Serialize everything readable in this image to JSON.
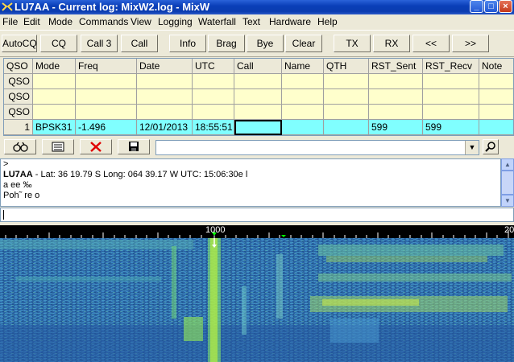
{
  "titlebar": {
    "title": "LU7AA - Current log: MixW2.log - MixW",
    "minimize": "_",
    "maximize": "□",
    "close": "×"
  },
  "menu": [
    "File",
    "Edit",
    "Mode",
    "Commands",
    "View",
    "Logging",
    "Waterfall",
    "Text",
    "Hardware",
    "Help"
  ],
  "toolbar": [
    "AutoCQ",
    "CQ",
    "Call 3",
    "Call",
    "Info",
    "Brag",
    "Bye",
    "Clear",
    "TX",
    "RX",
    "<<",
    ">>"
  ],
  "log": {
    "headers": [
      "QSO",
      "Mode",
      "Freq",
      "Date",
      "UTC",
      "Call",
      "Name",
      "QTH",
      "RST_Sent",
      "RST_Recv",
      "Note"
    ],
    "empty_rows": [
      "QSO",
      "QSO",
      "QSO"
    ],
    "current": {
      "num": "1",
      "mode": "BPSK31",
      "freq": "-1.496",
      "date": "12/01/2013",
      "utc": "18:55:51",
      "call": "",
      "name": "",
      "qth": "",
      "rst_sent": "599",
      "rst_recv": "599",
      "note": ""
    }
  },
  "icons": {
    "binoculars": "binoculars-icon",
    "form": "form-icon",
    "delete": "delete-icon",
    "save": "save-icon",
    "search": "search-icon"
  },
  "receive": {
    "line1": ">",
    "station": "LU7AA",
    "sep": " - ",
    "info": "Lat:  36 19.79 S   Long: 064 39.17 W   UTC: 15:06:30e l",
    "line3": "a ee ‰",
    "line4": "Poh˜ re o"
  },
  "waterfall": {
    "tick_1000": "1000",
    "tick_2000": "20"
  },
  "colors": {
    "rx_grid_current": "#80ffff",
    "grid_empty": "#ffffcc",
    "title_bar": "#0a3fb8",
    "delete_icon": "#e00000"
  }
}
